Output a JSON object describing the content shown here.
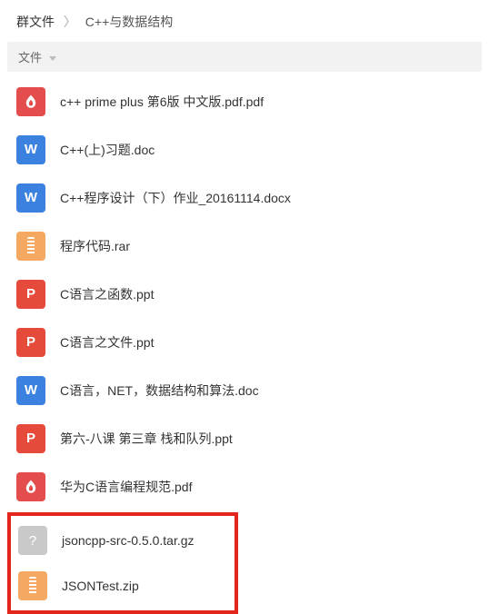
{
  "breadcrumb": {
    "root": "群文件",
    "current": "C++与数据结构"
  },
  "columns": {
    "name_label": "文件"
  },
  "files": [
    {
      "name": "c++ prime plus 第6版 中文版.pdf.pdf",
      "icon": "pdf"
    },
    {
      "name": "C++(上)习题.doc",
      "icon": "doc"
    },
    {
      "name": "C++程序设计（下）作业_20161114.docx",
      "icon": "doc"
    },
    {
      "name": "程序代码.rar",
      "icon": "zip"
    },
    {
      "name": "C语言之函数.ppt",
      "icon": "ppt"
    },
    {
      "name": "C语言之文件.ppt",
      "icon": "ppt"
    },
    {
      "name": "C语言，NET，数据结构和算法.doc",
      "icon": "doc"
    },
    {
      "name": "第六-八课 第三章 栈和队列.ppt",
      "icon": "ppt"
    },
    {
      "name": "华为C语言编程规范.pdf",
      "icon": "pdf"
    },
    {
      "name": "jsoncpp-src-0.5.0.tar.gz",
      "icon": "unknown"
    },
    {
      "name": "JSONTest.zip",
      "icon": "zip"
    }
  ],
  "icon_letters": {
    "doc": "W",
    "ppt": "P",
    "unknown": "?"
  }
}
